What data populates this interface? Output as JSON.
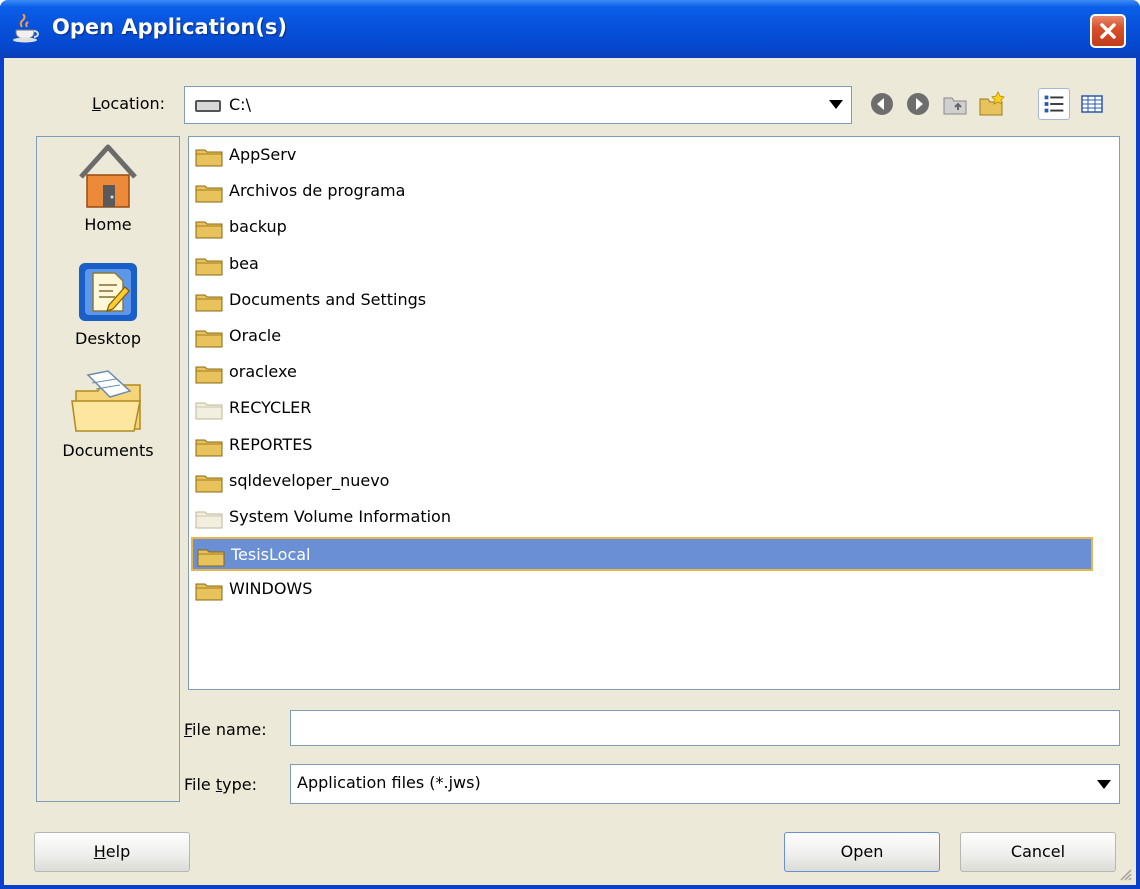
{
  "window": {
    "title": "Open Application(s)"
  },
  "location": {
    "label_prefix": "",
    "label_accel": "L",
    "label_rest": "ocation:",
    "value": "C:\\"
  },
  "toolbar": {
    "icons": [
      "back-icon",
      "forward-icon",
      "up-folder-icon",
      "new-folder-icon",
      "list-view-icon",
      "details-view-icon"
    ]
  },
  "places": [
    {
      "label": "Home",
      "icon": "home-icon"
    },
    {
      "label": "Desktop",
      "icon": "desktop-icon"
    },
    {
      "label": "Documents",
      "icon": "documents-icon"
    }
  ],
  "files": [
    {
      "name": "AppServ",
      "hidden": false,
      "selected": false
    },
    {
      "name": "Archivos de programa",
      "hidden": false,
      "selected": false
    },
    {
      "name": "backup",
      "hidden": false,
      "selected": false
    },
    {
      "name": "bea",
      "hidden": false,
      "selected": false
    },
    {
      "name": "Documents and Settings",
      "hidden": false,
      "selected": false
    },
    {
      "name": "Oracle",
      "hidden": false,
      "selected": false
    },
    {
      "name": "oraclexe",
      "hidden": false,
      "selected": false
    },
    {
      "name": "RECYCLER",
      "hidden": true,
      "selected": false
    },
    {
      "name": "REPORTES",
      "hidden": false,
      "selected": false
    },
    {
      "name": "sqldeveloper_nuevo",
      "hidden": false,
      "selected": false
    },
    {
      "name": "System Volume Information",
      "hidden": true,
      "selected": false
    },
    {
      "name": "TesisLocal",
      "hidden": false,
      "selected": true
    },
    {
      "name": "WINDOWS",
      "hidden": false,
      "selected": false
    }
  ],
  "file_name": {
    "label_accel": "F",
    "label_rest": "ile name:",
    "value": ""
  },
  "file_type": {
    "label_prefix": "File ",
    "label_accel": "t",
    "label_rest": "ype:",
    "value": "Application files  (*.jws)"
  },
  "buttons": {
    "help_accel": "H",
    "help_rest": "elp",
    "open": "Open",
    "cancel": "Cancel"
  },
  "colors": {
    "title_bar": "#0752dc",
    "selection": "#6a8fd4",
    "folder": "#e8c25a",
    "close": "#d8502c"
  }
}
